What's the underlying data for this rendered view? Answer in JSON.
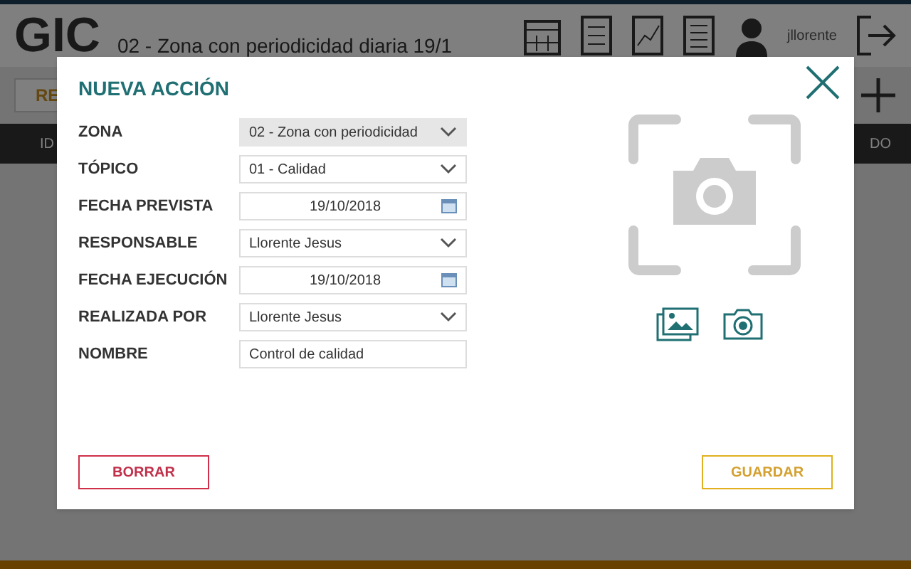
{
  "app": {
    "logo": "GIC",
    "title": "02 - Zona con periodicidad diaria 19/1",
    "user": "jllorente",
    "tab_button": "RE",
    "columns": [
      "ID",
      "DO"
    ]
  },
  "dialog": {
    "title": "NUEVA ACCIÓN",
    "fields": [
      {
        "label": "ZONA",
        "kind": "select",
        "value": "02 - Zona con periodicidad",
        "disabled": true
      },
      {
        "label": "TÓPICO",
        "kind": "select",
        "value": "01 - Calidad",
        "disabled": false
      },
      {
        "label": "FECHA PREVISTA",
        "kind": "date",
        "value": "19/10/2018",
        "disabled": false
      },
      {
        "label": "RESPONSABLE",
        "kind": "select",
        "value": "Llorente Jesus",
        "disabled": false
      },
      {
        "label": "FECHA EJECUCIÓN",
        "kind": "date",
        "value": "19/10/2018",
        "disabled": false
      },
      {
        "label": "REALIZADA POR",
        "kind": "select",
        "value": "Llorente Jesus",
        "disabled": false
      },
      {
        "label": "NOMBRE",
        "kind": "text",
        "value": "Control de calidad",
        "disabled": false
      }
    ],
    "buttons": [
      {
        "label": "BORRAR",
        "kind": "delete"
      },
      {
        "label": "GUARDAR",
        "kind": "save"
      }
    ]
  }
}
